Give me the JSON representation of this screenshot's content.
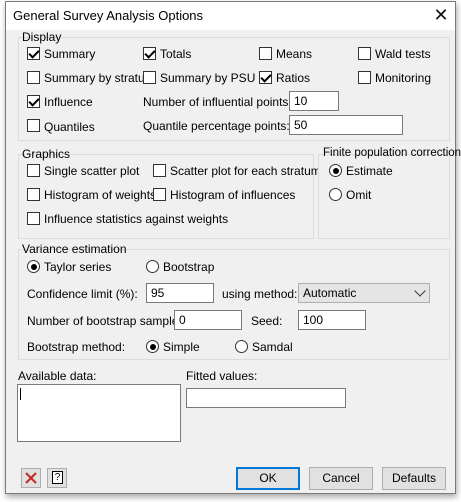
{
  "window": {
    "title": "General Survey Analysis Options",
    "close_glyph": "✕"
  },
  "display": {
    "title": "Display",
    "summary": {
      "label": "Summary",
      "checked": true
    },
    "totals": {
      "label": "Totals",
      "checked": true
    },
    "means": {
      "label": "Means",
      "checked": false
    },
    "wald_tests": {
      "label": "Wald tests",
      "checked": false
    },
    "summary_by_stratum": {
      "label": "Summary by stratum",
      "checked": false
    },
    "summary_by_psu": {
      "label": "Summary by PSU",
      "checked": false
    },
    "ratios": {
      "label": "Ratios",
      "checked": true
    },
    "monitoring": {
      "label": "Monitoring",
      "checked": false
    },
    "influence": {
      "label": "Influence",
      "checked": true
    },
    "quantiles": {
      "label": "Quantiles",
      "checked": false
    },
    "num_influential_label": "Number of influential points:",
    "num_influential_value": "10",
    "quantile_pct_label": "Quantile percentage points:",
    "quantile_pct_value": "50"
  },
  "graphics": {
    "title": "Graphics",
    "single_scatter": {
      "label": "Single scatter plot",
      "checked": false
    },
    "scatter_each_stratum": {
      "label": "Scatter plot for each stratum",
      "checked": false
    },
    "hist_weights": {
      "label": "Histogram of weights",
      "checked": false
    },
    "hist_influences": {
      "label": "Histogram of influences",
      "checked": false
    },
    "influence_vs_weights": {
      "label": "Influence statistics against weights",
      "checked": false
    }
  },
  "fpc": {
    "title": "Finite population correction",
    "estimate": {
      "label": "Estimate",
      "checked": true
    },
    "omit": {
      "label": "Omit",
      "checked": false
    }
  },
  "variance": {
    "title": "Variance estimation",
    "taylor": {
      "label": "Taylor series",
      "checked": true
    },
    "bootstrap": {
      "label": "Bootstrap",
      "checked": false
    },
    "confidence_label": "Confidence limit (%):",
    "confidence_value": "95",
    "method_label": "using method:",
    "method_value": "Automatic",
    "num_bootstrap_label": "Number of bootstrap samples:",
    "num_bootstrap_value": "0",
    "seed_label": "Seed:",
    "seed_value": "100",
    "boot_method_label": "Bootstrap method:",
    "simple": {
      "label": "Simple",
      "checked": true
    },
    "samdal": {
      "label": "Samdal",
      "checked": false
    }
  },
  "available_data": {
    "label": "Available data:"
  },
  "fitted_values": {
    "label": "Fitted values:",
    "value": ""
  },
  "buttons": {
    "ok": "OK",
    "cancel": "Cancel",
    "defaults": "Defaults",
    "help_glyph": "?"
  },
  "colors": {
    "close_icon": "#c42b1c",
    "default_border": "#0078d7"
  }
}
